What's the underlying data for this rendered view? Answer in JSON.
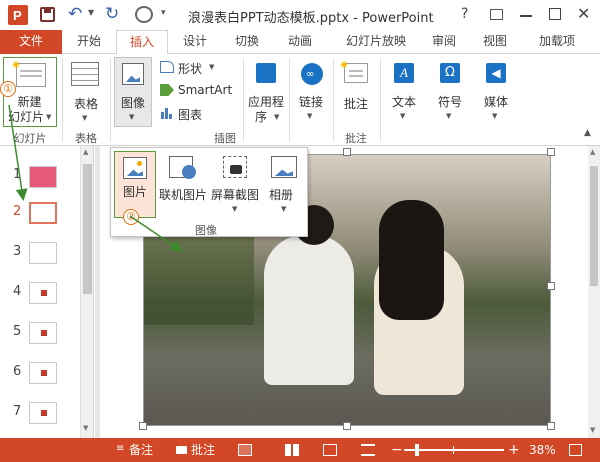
{
  "title": "浪漫表白PPT动态模板.pptx - PowerPoint",
  "window_controls": {
    "help": "?"
  },
  "tabs": [
    "文件",
    "开始",
    "插入",
    "设计",
    "切换",
    "动画",
    "幻灯片放映",
    "审阅",
    "视图",
    "加载项"
  ],
  "ribbon": {
    "new_slide_line1": "新建",
    "new_slide_line2": "幻灯片",
    "new_slide_group": "幻灯片",
    "table": "表格",
    "table_group": "表格",
    "image": "图像",
    "shapes": "形状",
    "smartart": "SmartArt",
    "chart": "图表",
    "illustrations_group": "插图",
    "apps_line1": "应用程",
    "apps_line2": "序",
    "links": "链接",
    "comment": "批注",
    "comment_group": "批注",
    "text": "文本",
    "symbols": "符号",
    "media": "媒体"
  },
  "dropdown": {
    "picture": "图片",
    "online_picture": "联机图片",
    "screenshot": "屏幕截图",
    "album": "相册",
    "group_label": "图像"
  },
  "annotations": {
    "step1": "①",
    "step2": "②"
  },
  "slides": [
    {
      "num": "1"
    },
    {
      "num": "2"
    },
    {
      "num": "3"
    },
    {
      "num": "4"
    },
    {
      "num": "5"
    },
    {
      "num": "6"
    },
    {
      "num": "7"
    }
  ],
  "status": {
    "notes": "备注",
    "comments": "批注",
    "zoom_minus": "−",
    "zoom_plus": "+",
    "zoom": "38%",
    "zoom_level_fraction": 0.38
  },
  "colors": {
    "accent": "#d24726",
    "selection": "#5b9b3f"
  }
}
